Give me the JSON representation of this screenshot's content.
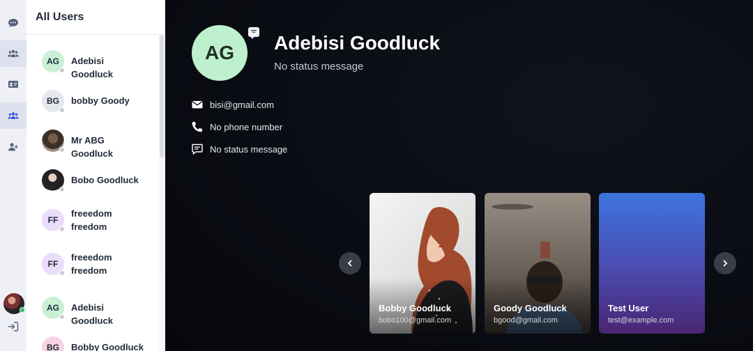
{
  "sidebar": {
    "title": "All Users",
    "users": [
      {
        "initials": "AG",
        "name": "Adebisi Goodluck",
        "color": "#c9f0d4",
        "photo": false
      },
      {
        "initials": "BG",
        "name": "bobby Goody",
        "color": "#e4e7ee",
        "photo": false
      },
      {
        "initials": "",
        "name": "Mr ABG Goodluck",
        "color": "#6b5a52",
        "photo": true
      },
      {
        "initials": "",
        "name": "Bobo Goodluck",
        "color": "#d9d9d9",
        "photo": true
      },
      {
        "initials": "FF",
        "name": "freeedom freedom",
        "color": "#eadcfb",
        "photo": false
      },
      {
        "initials": "FF",
        "name": "freeedom freedom",
        "color": "#eadcfb",
        "photo": false
      },
      {
        "initials": "AG",
        "name": "Adebisi Goodluck",
        "color": "#c9f0d4",
        "photo": false
      },
      {
        "initials": "BG",
        "name": "Bobby Goodluck",
        "color": "#f6d4e4",
        "photo": false
      }
    ]
  },
  "profile": {
    "initials": "AG",
    "name": "Adebisi Goodluck",
    "status": "No status message",
    "email": "bisi@gmail.com",
    "phone": "No phone number",
    "status_line": "No status message"
  },
  "carousel": {
    "cards": [
      {
        "name": "Bobby Goodluck",
        "email": "bobo100@gmail.com"
      },
      {
        "name": "Goody Goodluck",
        "email": "bgood@gmail.com"
      },
      {
        "name": "Test User",
        "email": "test@example.com"
      }
    ]
  }
}
